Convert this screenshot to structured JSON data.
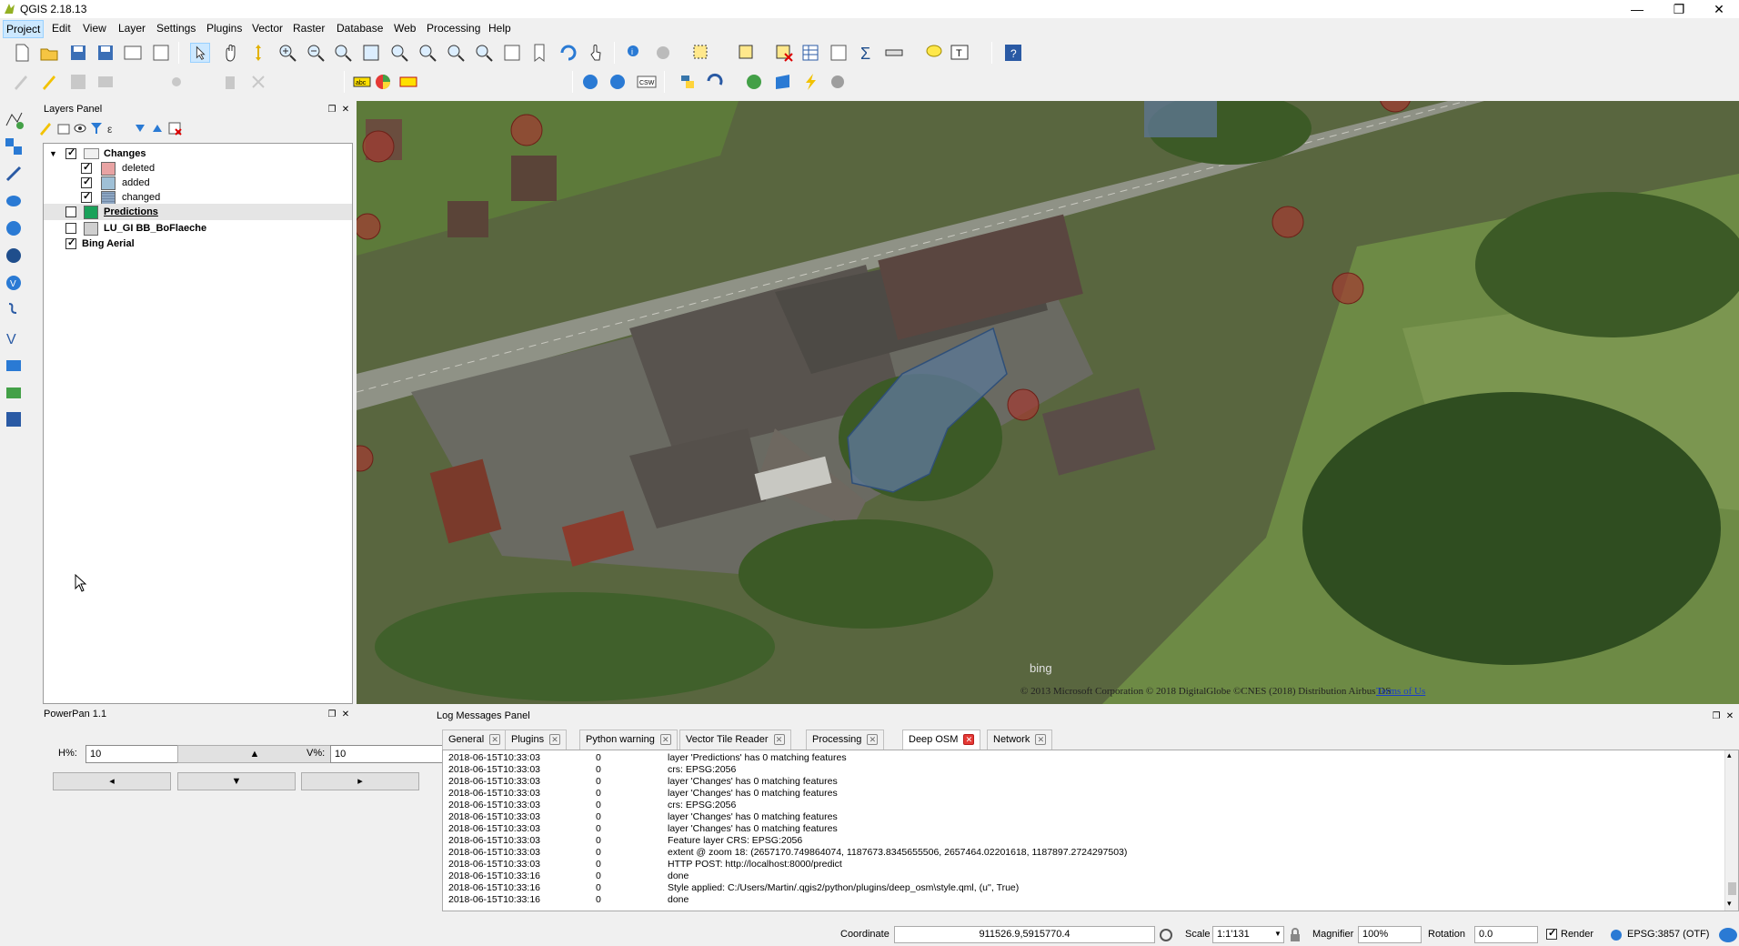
{
  "window": {
    "title": "QGIS 2.18.13",
    "minimize": "—",
    "maximize": "❐",
    "close": "✕"
  },
  "menubar": {
    "items": [
      "Project",
      "Edit",
      "View",
      "Layer",
      "Settings",
      "Plugins",
      "Vector",
      "Raster",
      "Database",
      "Web",
      "Processing",
      "Help"
    ]
  },
  "layers_panel": {
    "title": "Layers Panel",
    "layers": [
      {
        "name": "Changes",
        "checked": true,
        "group": true
      },
      {
        "name": "deleted",
        "checked": true,
        "color": "#e8a3a3"
      },
      {
        "name": "added",
        "checked": true,
        "color": "#9fc0d6"
      },
      {
        "name": "changed",
        "checked": true,
        "color": "#8da6c2"
      },
      {
        "name": "Predictions",
        "checked": false,
        "color": "#1aa15a"
      },
      {
        "name": "LU_GI BB_BoFlaeche",
        "checked": false,
        "color": "#cfcfcf"
      },
      {
        "name": "Bing Aerial",
        "checked": true
      }
    ]
  },
  "powerpan": {
    "title": "PowerPan 1.1",
    "h_label": "H%:",
    "h_value": "10",
    "v_label": "V%:",
    "v_value": "10",
    "up": "▲",
    "down": "▼",
    "left": "◂",
    "right": "▸"
  },
  "map": {
    "watermark": "bing",
    "attribution": "© 2013 Microsoft Corporation © 2018 DigitalGlobe ©CNES (2018) Distribution Airbus DS",
    "terms_link": "Terms of Us"
  },
  "log_panel": {
    "title": "Log Messages Panel",
    "tabs": [
      "General",
      "Plugins",
      "Python warning",
      "Vector Tile Reader",
      "Processing",
      "Deep OSM",
      "Network"
    ],
    "active_tab": "Deep OSM",
    "lines": [
      {
        "time": "2018-06-15T10:33:03",
        "level": "0",
        "msg": "layer 'Predictions' has 0 matching features"
      },
      {
        "time": "2018-06-15T10:33:03",
        "level": "0",
        "msg": "crs: EPSG:2056"
      },
      {
        "time": "2018-06-15T10:33:03",
        "level": "0",
        "msg": "layer 'Changes' has 0 matching features"
      },
      {
        "time": "2018-06-15T10:33:03",
        "level": "0",
        "msg": "layer 'Changes' has 0 matching features"
      },
      {
        "time": "2018-06-15T10:33:03",
        "level": "0",
        "msg": "crs: EPSG:2056"
      },
      {
        "time": "2018-06-15T10:33:03",
        "level": "0",
        "msg": "layer 'Changes' has 0 matching features"
      },
      {
        "time": "2018-06-15T10:33:03",
        "level": "0",
        "msg": "layer 'Changes' has 0 matching features"
      },
      {
        "time": "2018-06-15T10:33:03",
        "level": "0",
        "msg": "Feature layer CRS: EPSG:2056"
      },
      {
        "time": "2018-06-15T10:33:03",
        "level": "0",
        "msg": "extent @ zoom 18: (2657170.749864074, 1187673.8345655506, 2657464.02201618, 1187897.2724297503)"
      },
      {
        "time": "2018-06-15T10:33:03",
        "level": "0",
        "msg": "HTTP POST: http://localhost:8000/predict"
      },
      {
        "time": "2018-06-15T10:33:16",
        "level": "0",
        "msg": "done"
      },
      {
        "time": "2018-06-15T10:33:16",
        "level": "0",
        "msg": "Style applied: C:/Users/Martin/.qgis2/python/plugins/deep_osm\\style.qml, (u'', True)"
      },
      {
        "time": "2018-06-15T10:33:16",
        "level": "0",
        "msg": "done"
      }
    ]
  },
  "statusbar": {
    "coordinate_label": "Coordinate",
    "coordinate_value": "911526.9,5915770.4",
    "scale_label": "Scale",
    "scale_value": "1:1'131",
    "magnifier_label": "Magnifier",
    "magnifier_value": "100%",
    "rotation_label": "Rotation",
    "rotation_value": "0.0",
    "render_label": "Render",
    "render_checked": true,
    "crs": "EPSG:3857 (OTF)"
  }
}
